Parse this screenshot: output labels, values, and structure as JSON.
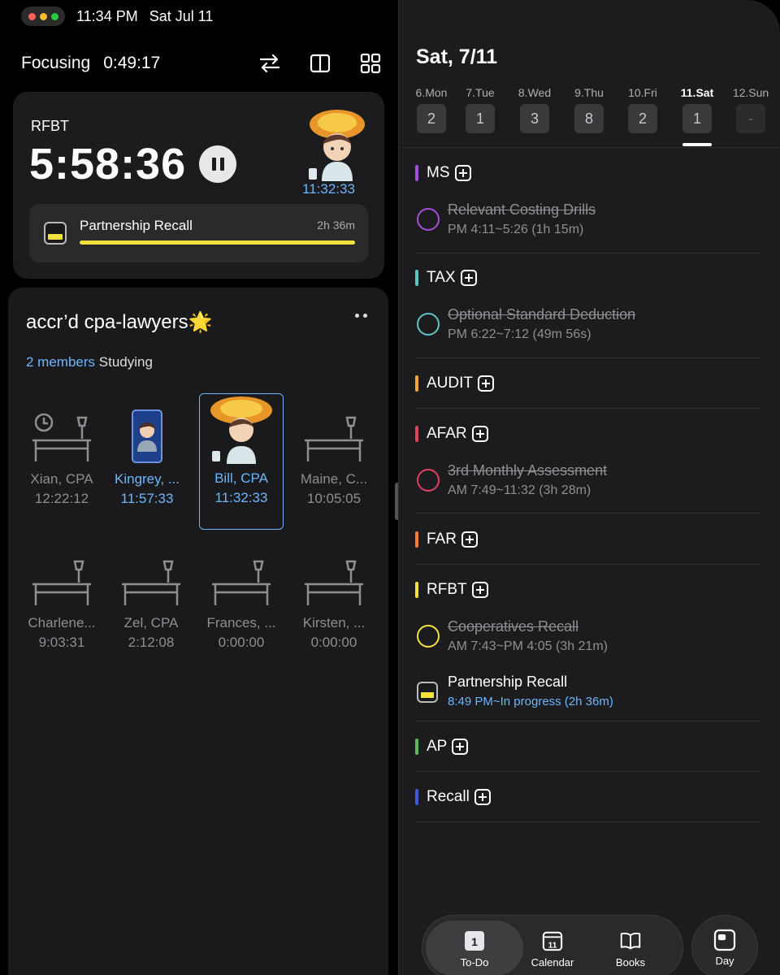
{
  "status": {
    "time": "11:34 PM",
    "date": "Sat Jul 11"
  },
  "left": {
    "focus_label": "Focusing",
    "focus_time": "0:49:17",
    "timer": {
      "subject": "RFBT",
      "elapsed": "5:58:36",
      "avatar_time": "11:32:33",
      "task_name": "Partnership Recall",
      "task_duration": "2h 36m",
      "progress": 1.0
    },
    "group": {
      "title": "accr’d cpa-lawyers🌟",
      "members_count": "2 members",
      "members_state": "Studying",
      "members": [
        {
          "name": "Xian, CPA",
          "time": "12:22:12"
        },
        {
          "name": "Kingrey, ...",
          "time": "11:57:33"
        },
        {
          "name": "Bill, CPA",
          "time": "11:32:33"
        },
        {
          "name": "Maine, C...",
          "time": "10:05:05"
        },
        {
          "name": "Charlene...",
          "time": "9:03:31"
        },
        {
          "name": "Zel, CPA",
          "time": "2:12:08"
        },
        {
          "name": "Frances, ...",
          "time": "0:00:00"
        },
        {
          "name": "Kirsten, ...",
          "time": "0:00:00"
        }
      ]
    }
  },
  "right": {
    "date_title": "Sat, 7/11",
    "week": [
      {
        "label": "6.Mon",
        "count": "2"
      },
      {
        "label": "7.Tue",
        "count": "1"
      },
      {
        "label": "8.Wed",
        "count": "3"
      },
      {
        "label": "9.Thu",
        "count": "8"
      },
      {
        "label": "10.Fri",
        "count": "2"
      },
      {
        "label": "11.Sat",
        "count": "1"
      },
      {
        "label": "12.Sun",
        "count": "-"
      }
    ],
    "sections": [
      {
        "name": "MS",
        "color": "#a64fd6"
      },
      {
        "name": "TAX",
        "color": "#5fc5c0"
      },
      {
        "name": "AUDIT",
        "color": "#f3a54a"
      },
      {
        "name": "AFAR",
        "color": "#e0415f"
      },
      {
        "name": "FAR",
        "color": "#f07a3c"
      },
      {
        "name": "RFBT",
        "color": "#f5e13d"
      },
      {
        "name": "AP",
        "color": "#5fb85a"
      },
      {
        "name": "Recall",
        "color": "#3f5bd8"
      }
    ],
    "tasks": [
      {
        "title": "Relevant Costing Drills",
        "time": "PM 4:11~5:26 (1h 15m)"
      },
      {
        "title": "Optional Standard Deduction",
        "time": "PM 6:22~7:12 (49m 56s)"
      },
      {
        "title": "3rd Monthly Assessment",
        "time": "AM 7:49~11:32 (3h 28m)"
      },
      {
        "title": "Cooperatives Recall",
        "time": "AM 7:43~PM 4:05 (3h 21m)"
      },
      {
        "title": "Partnership Recall",
        "time": "8:49 PM~In progress (2h 36m)"
      }
    ],
    "tabs": {
      "todo": "To-Do",
      "todo_badge": "1",
      "calendar": "Calendar",
      "calendar_badge": "11",
      "books": "Books",
      "day": "Day"
    }
  }
}
